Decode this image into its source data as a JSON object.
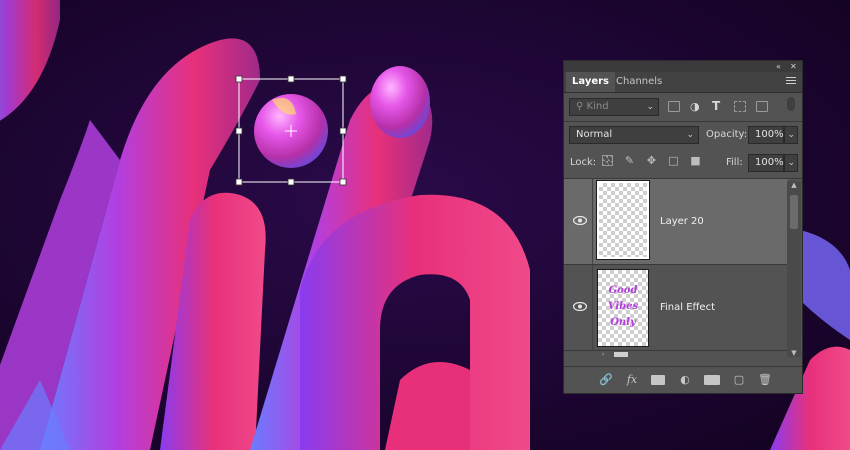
{
  "panel": {
    "tabs": [
      {
        "label": "Layers",
        "active": true
      },
      {
        "label": "Channels",
        "active": false
      }
    ],
    "filter": {
      "kind_label": "Kind"
    },
    "blend_mode": "Normal",
    "opacity": {
      "label": "Opacity:",
      "value": "100%"
    },
    "lock": {
      "label": "Lock:"
    },
    "fill": {
      "label": "Fill:",
      "value": "100%"
    },
    "layers": [
      {
        "name": "Layer 20",
        "visible": true,
        "selected": true
      },
      {
        "name": "Final Effect",
        "visible": true,
        "selected": false,
        "thumb_text": [
          "Good",
          "Vibes",
          "Only"
        ]
      }
    ]
  },
  "icons": {
    "collapse": "double-chevron-icon",
    "close": "close-icon",
    "panel_menu": "hamburger-menu-icon"
  },
  "colors": {
    "panel_bg": "#535353",
    "selected_layer": "#6a6a6a",
    "canvas_bg": "#1a0630",
    "tube_pink": "#e8307a",
    "tube_purple": "#8a3cf0"
  }
}
